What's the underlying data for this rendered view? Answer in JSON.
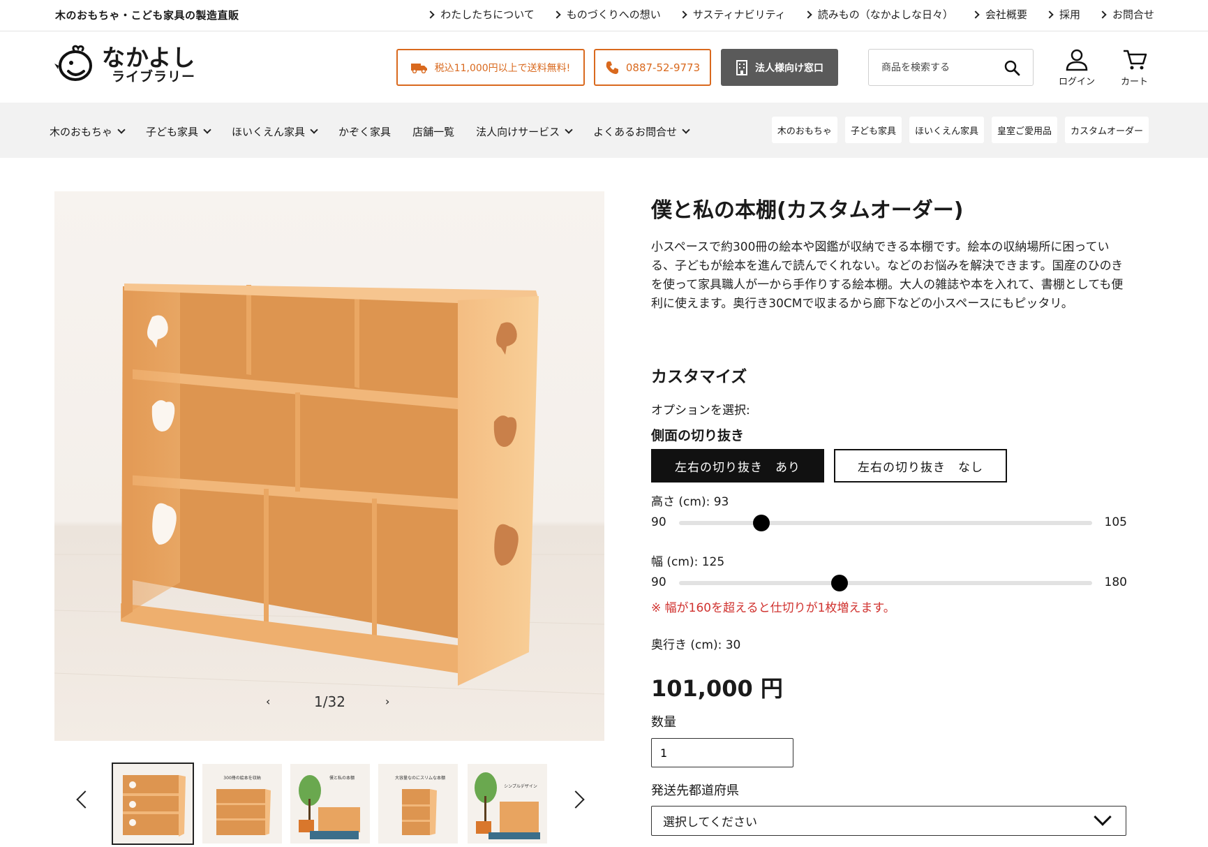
{
  "topbar": {
    "tagline": "木のおもちゃ・こども家具の製造直販",
    "links": [
      "わたしたちについて",
      "ものづくりへの想い",
      "サスティナビリティ",
      "読みもの（なかよしな日々）",
      "会社概要",
      "採用",
      "お問合せ"
    ]
  },
  "header": {
    "logo_main": "なかよし",
    "logo_sub": "ライブラリー",
    "shipping_label": "税込11,000円以上で送料無料!",
    "phone_label": "0887-52-9773",
    "corporate_label": "法人様向け窓口",
    "search_placeholder": "商品を検索する",
    "login_label": "ログイン",
    "cart_label": "カート",
    "accent_color": "#d9691e"
  },
  "category_nav": {
    "menu": [
      {
        "label": "木のおもちゃ",
        "dropdown": true
      },
      {
        "label": "子ども家具",
        "dropdown": true
      },
      {
        "label": "ほいくえん家具",
        "dropdown": true
      },
      {
        "label": "かぞく家具",
        "dropdown": false
      },
      {
        "label": "店舗一覧",
        "dropdown": false
      },
      {
        "label": "法人向けサービス",
        "dropdown": true
      },
      {
        "label": "よくあるお問合せ",
        "dropdown": true
      }
    ],
    "chips": [
      "木のおもちゃ",
      "子ども家具",
      "ほいくえん家具",
      "皇室ご愛用品",
      "カスタムオーダー"
    ]
  },
  "gallery": {
    "counter": "1/32",
    "prev_icon": "chevron-left-icon",
    "next_icon": "chevron-right-icon",
    "thumbnail_count": 5,
    "thumb_captions": [
      "",
      "300冊の絵本を収納",
      "僕と私の本棚",
      "大容量なのにスリムな本棚",
      "シンプルデザイン"
    ]
  },
  "product": {
    "title": "僕と私の本棚(カスタムオーダー)",
    "description": "小スペースで約300冊の絵本や図鑑が収納できる本棚です。絵本の収納場所に困っている、子どもが絵本を進んで読んでくれない。などのお悩みを解決できます。国産のひのきを使って家具職人が一から手作りする絵本棚。大人の雑誌や本を入れて、書棚としても便利に使えます。奥行き30CMで収まるから廊下などの小スペースにもピッタリ。",
    "customize_heading": "カスタマイズ",
    "option_prompt": "オプションを選択:",
    "side_cutout_label": "側面の切り抜き",
    "cutout_options": [
      "左右の切り抜き　あり",
      "左右の切り抜き　なし"
    ],
    "height_label": "高さ (cm): 93",
    "height": {
      "min": "90",
      "max": "105",
      "value": 93
    },
    "width_label": "幅 (cm): 125",
    "width": {
      "min": "90",
      "max": "180",
      "value": 125
    },
    "width_note": "※ 幅が160を超えると仕切りが1枚増えます。",
    "depth_label": "奥行き (cm): 30",
    "price": "101,000 円",
    "quantity_label": "数量",
    "quantity_value": "1",
    "prefecture_label": "発送先都道府県",
    "prefecture_placeholder": "選択してください",
    "note_color": "#d0322f"
  }
}
